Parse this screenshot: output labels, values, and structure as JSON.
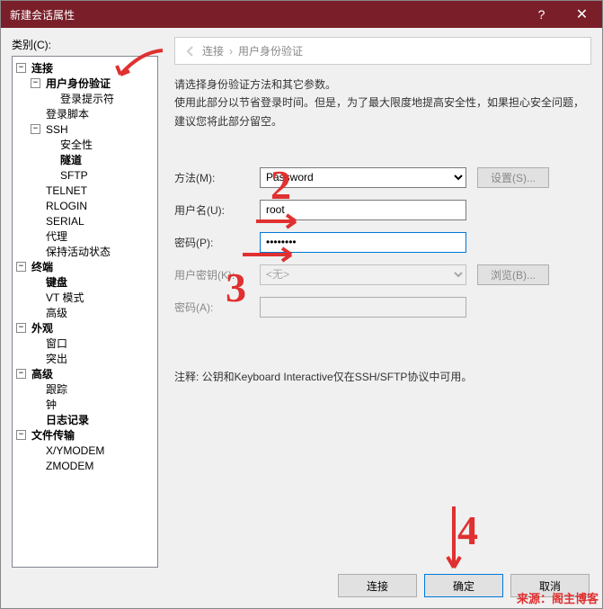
{
  "titlebar": {
    "title": "新建会话属性"
  },
  "category_label": "类别(C):",
  "breadcrumb": {
    "root": "连接",
    "current": "用户身份验证"
  },
  "description": {
    "line1": "请选择身份验证方法和其它参数。",
    "line2": "使用此部分以节省登录时间。但是，为了最大限度地提高安全性，如果担心安全问题，建议您将此部分留空。"
  },
  "form": {
    "method_label": "方法(M):",
    "method_value": "Password",
    "user_label": "用户名(U):",
    "user_value": "root",
    "pwd_label": "密码(P):",
    "pwd_value": "••••••••",
    "userkey_label": "用户密钥(K):",
    "userkey_value": "<无>",
    "pwd2_label": "密码(A):",
    "settings_btn": "设置(S)...",
    "browse_btn": "浏览(B)..."
  },
  "note": "注释: 公钥和Keyboard Interactive仅在SSH/SFTP协议中可用。",
  "footer": {
    "connect": "连接",
    "ok": "确定",
    "cancel": "取消"
  },
  "watermark": "来源：阁主博客",
  "tree": {
    "connection": "连接",
    "auth": "用户身份验证",
    "login_prompt": "登录提示符",
    "login_script": "登录脚本",
    "ssh": "SSH",
    "security": "安全性",
    "tunnel": "隧道",
    "sftp": "SFTP",
    "telnet": "TELNET",
    "rlogin": "RLOGIN",
    "serial": "SERIAL",
    "proxy": "代理",
    "keepalive": "保持活动状态",
    "terminal": "终端",
    "keyboard": "键盘",
    "vtmode": "VT 模式",
    "advanced": "高级",
    "appearance": "外观",
    "window": "窗口",
    "highlight": "突出",
    "advanced2": "高级",
    "trace": "跟踪",
    "bell": "钟",
    "logging": "日志记录",
    "filetransfer": "文件传输",
    "xymodem": "X/YMODEM",
    "zmodem": "ZMODEM"
  }
}
